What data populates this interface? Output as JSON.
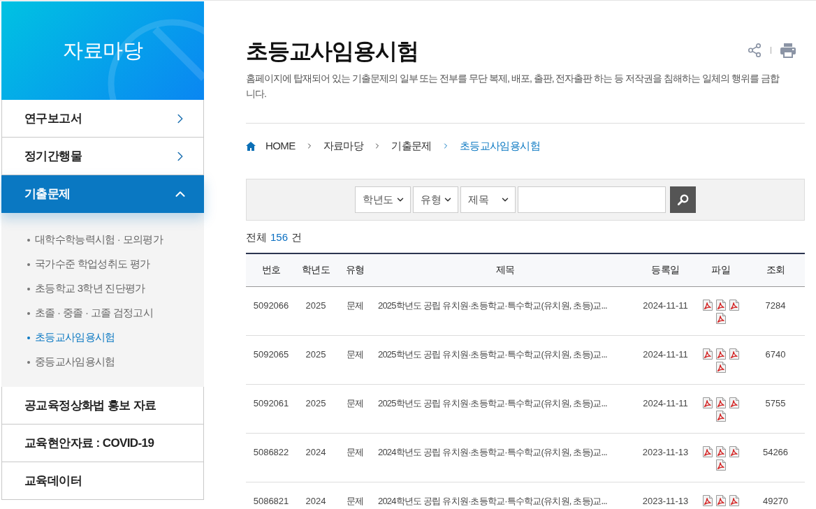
{
  "sidebar": {
    "title": "자료마당",
    "items": [
      {
        "kind": "group",
        "label": "연구보고서",
        "expanded": false
      },
      {
        "kind": "group",
        "label": "정기간행물",
        "expanded": false
      },
      {
        "kind": "group",
        "label": "기출문제",
        "expanded": true,
        "children": [
          {
            "label": "대학수학능력시험 · 모의평가",
            "selected": false
          },
          {
            "label": "국가수준 학업성취도 평가",
            "selected": false
          },
          {
            "label": "초등학교 3학년 진단평가",
            "selected": false
          },
          {
            "label": "초졸 · 중졸 · 고졸 검정고시",
            "selected": false
          },
          {
            "label": "초등교사임용시험",
            "selected": true
          },
          {
            "label": "중등교사임용시험",
            "selected": false
          }
        ]
      },
      {
        "kind": "link",
        "label": "공교육정상화법 홍보 자료"
      },
      {
        "kind": "link",
        "label": "교육현안자료 : COVID-19"
      },
      {
        "kind": "link",
        "label": "교육데이터"
      }
    ]
  },
  "page": {
    "title": "초등교사임용시험",
    "notice": "홈페이지에 탑재되어 있는 기출문제의 일부 또는 전부를 무단 복제, 배포, 출판, 전자출판 하는 등 저작권을 침해하는 일체의 행위를 금합니다."
  },
  "breadcrumb": [
    {
      "label": "HOME",
      "current": false
    },
    {
      "label": "자료마당",
      "current": false
    },
    {
      "label": "기출문제",
      "current": false
    },
    {
      "label": "초등교사임용시험",
      "current": true
    }
  ],
  "search": {
    "filters": [
      {
        "value": "학년도"
      },
      {
        "value": "유형"
      },
      {
        "value": "제목"
      }
    ]
  },
  "summary": {
    "label": "전체",
    "count": "156",
    "unit": "건"
  },
  "table": {
    "columns": [
      "번호",
      "학년도",
      "유형",
      "제목",
      "등록일",
      "파일",
      "조회"
    ],
    "rows": [
      {
        "number": "5092066",
        "year": "2025",
        "type": "문제",
        "title": "2025학년도 공립 유치원·초등학교·특수학교(유치원, 초등)교...",
        "date": "2024-11-11",
        "files": [
          {
            "kind": "pdf"
          },
          {
            "kind": "pdf"
          },
          {
            "kind": "pdf"
          },
          {
            "kind": "pdf"
          }
        ],
        "views": "7284"
      },
      {
        "number": "5092065",
        "year": "2025",
        "type": "문제",
        "title": "2025학년도 공립 유치원·초등학교·특수학교(유치원, 초등)교...",
        "date": "2024-11-11",
        "files": [
          {
            "kind": "pdf"
          },
          {
            "kind": "pdf"
          },
          {
            "kind": "pdf"
          },
          {
            "kind": "pdf"
          }
        ],
        "views": "6740"
      },
      {
        "number": "5092061",
        "year": "2025",
        "type": "문제",
        "title": "2025학년도 공립 유치원·초등학교·특수학교(유치원, 초등)교...",
        "date": "2024-11-11",
        "files": [
          {
            "kind": "pdf"
          },
          {
            "kind": "pdf"
          },
          {
            "kind": "pdf"
          },
          {
            "kind": "pdf"
          }
        ],
        "views": "5755"
      },
      {
        "number": "5086822",
        "year": "2024",
        "type": "문제",
        "title": "2024학년도 공립 유치원·초등학교·특수학교(유치원, 초등)교...",
        "date": "2023-11-13",
        "files": [
          {
            "kind": "pdf"
          },
          {
            "kind": "pdf"
          },
          {
            "kind": "pdf"
          },
          {
            "kind": "pdf"
          }
        ],
        "views": "54266"
      },
      {
        "number": "5086821",
        "year": "2024",
        "type": "문제",
        "title": "2024학년도 공립 유치원·초등학교·특수학교(유치원, 초등)교...",
        "date": "2023-11-13",
        "files": [
          {
            "kind": "pdf"
          },
          {
            "kind": "pdf"
          },
          {
            "kind": "pdf"
          }
        ],
        "views": "49270"
      }
    ]
  }
}
